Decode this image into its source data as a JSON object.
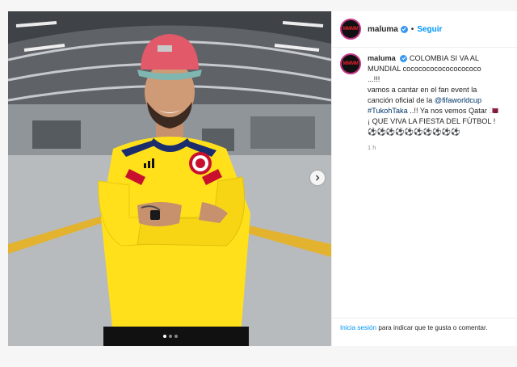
{
  "header": {
    "username": "maluma",
    "separator": "•",
    "follow_label": "Seguir",
    "avatar_text": "MMMM"
  },
  "caption": {
    "username": "maluma",
    "lines": [
      "COLOMBIA SI VA AL",
      "MUNDIAL cocococococococococo",
      "...!!!",
      "vamos a cantar en el fan event la",
      "canción oficial de la ",
      "..!! Ya nos vemos Qatar 🇶🇦",
      "¡ QUE VIVA LA FIESTA DEL FÚTBOL !",
      "⚽⚽⚽⚽⚽⚽⚽⚽⚽⚽"
    ],
    "mention": "@fifaworldcup",
    "hashtag": "#TukohTaka",
    "time": "1 h"
  },
  "footer": {
    "login_label": "Inicia sesión",
    "login_rest": " para indicar que te gusta o comentar."
  },
  "photo": {
    "jersey_color": "#ffe01b",
    "cap_color": "#e25a6a",
    "carousel_pages": 3,
    "carousel_active": 1
  }
}
